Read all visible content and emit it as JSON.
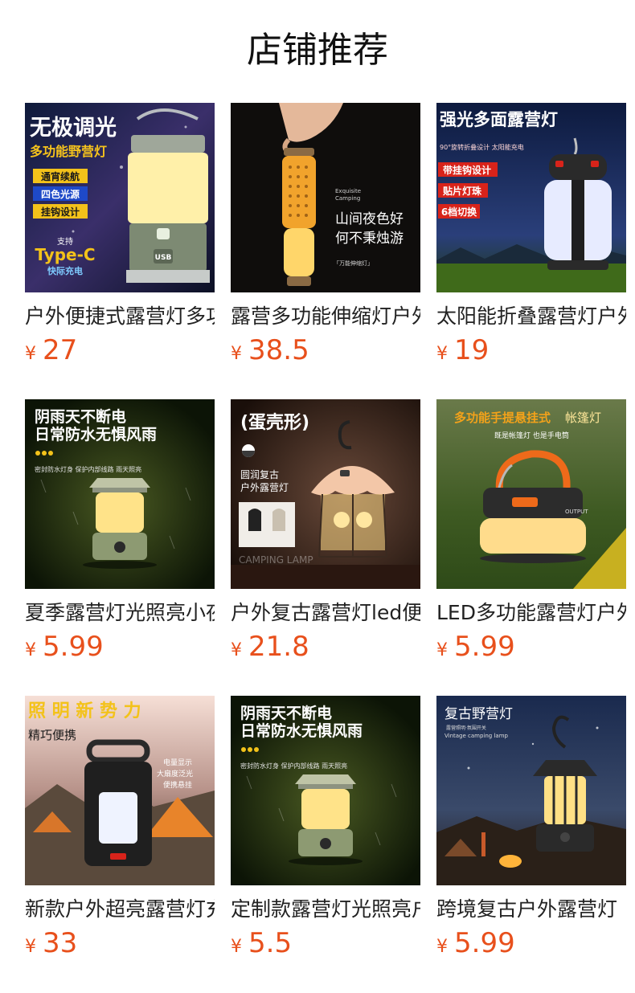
{
  "page": {
    "title": "店铺推荐"
  },
  "products": [
    {
      "name": "户外便捷式露营灯多功能无极调光野营灯",
      "currency": "¥",
      "price": "27",
      "overlay": {
        "headline": "无极调光",
        "subhead": "多功能野营灯",
        "tags": [
          "通宵续航",
          "四色光源",
          "挂钩设计"
        ],
        "support": "支持",
        "typec": "Type-C",
        "fast": "快际充电",
        "usb": "USB"
      }
    },
    {
      "name": "露营多功能伸缩灯户外野营灯",
      "currency": "¥",
      "price": "38.5",
      "overlay": {
        "en1": "Exquisite",
        "en2": "Camping",
        "line1": "山间夜色好",
        "line2": "何不秉烛游",
        "footer": "「万能伸缩灯」"
      }
    },
    {
      "name": "太阳能折叠露营灯户外充电",
      "currency": "¥",
      "price": "19",
      "overlay": {
        "headline": "强光多面露营灯",
        "sub": "90°旋转折叠设计 太阳能充电",
        "tags": [
          "带挂钩设计",
          "贴片灯珠",
          "6档切换"
        ]
      }
    },
    {
      "name": "夏季露营灯光照亮小夜灯户外",
      "currency": "¥",
      "price": "5.99",
      "overlay": {
        "line1": "阴雨天不断电",
        "line2": "日常防水无惧风雨",
        "small": "密封防水灯身 保护内部线路 雨天照亮"
      }
    },
    {
      "name": "户外复古露营灯led便携",
      "currency": "¥",
      "price": "21.8",
      "overlay": {
        "headline": "(蛋壳形)",
        "line1": "圆润复古",
        "line2": "户外露营灯",
        "watermark": "CAMPING LAMP"
      }
    },
    {
      "name": "LED多功能露营灯户外手提",
      "currency": "¥",
      "price": "5.99",
      "overlay": {
        "headline1": "多功能手提悬挂式",
        "headline2": "帐篷灯",
        "sub": "既是帐篷灯 也是手电筒",
        "output": "OUTPUT"
      }
    },
    {
      "name": "新款户外超亮露营灯充电",
      "currency": "¥",
      "price": "33",
      "overlay": {
        "headline": "照 明 新 势 力",
        "sub": "精巧便携",
        "notes": [
          "电量显示",
          "大扇度泛光",
          "便携悬挂"
        ]
      }
    },
    {
      "name": "定制款露营灯光照亮户外",
      "currency": "¥",
      "price": "5.5",
      "overlay": {
        "line1": "阴雨天不断电",
        "line2": "日常防水无惧风雨",
        "small": "密封防水灯身 保护内部线路 雨天照亮"
      }
    },
    {
      "name": "跨境复古户外露营灯",
      "currency": "¥",
      "price": "5.99",
      "overlay": {
        "headline": "复古野营灯",
        "sub": "露营照明·氛围开关",
        "en": "Vintage camping lamp"
      }
    }
  ],
  "colors": {
    "price": "#e8501c",
    "tag_bg": "#d8231a",
    "tag_yellow": "#f3c21a"
  }
}
